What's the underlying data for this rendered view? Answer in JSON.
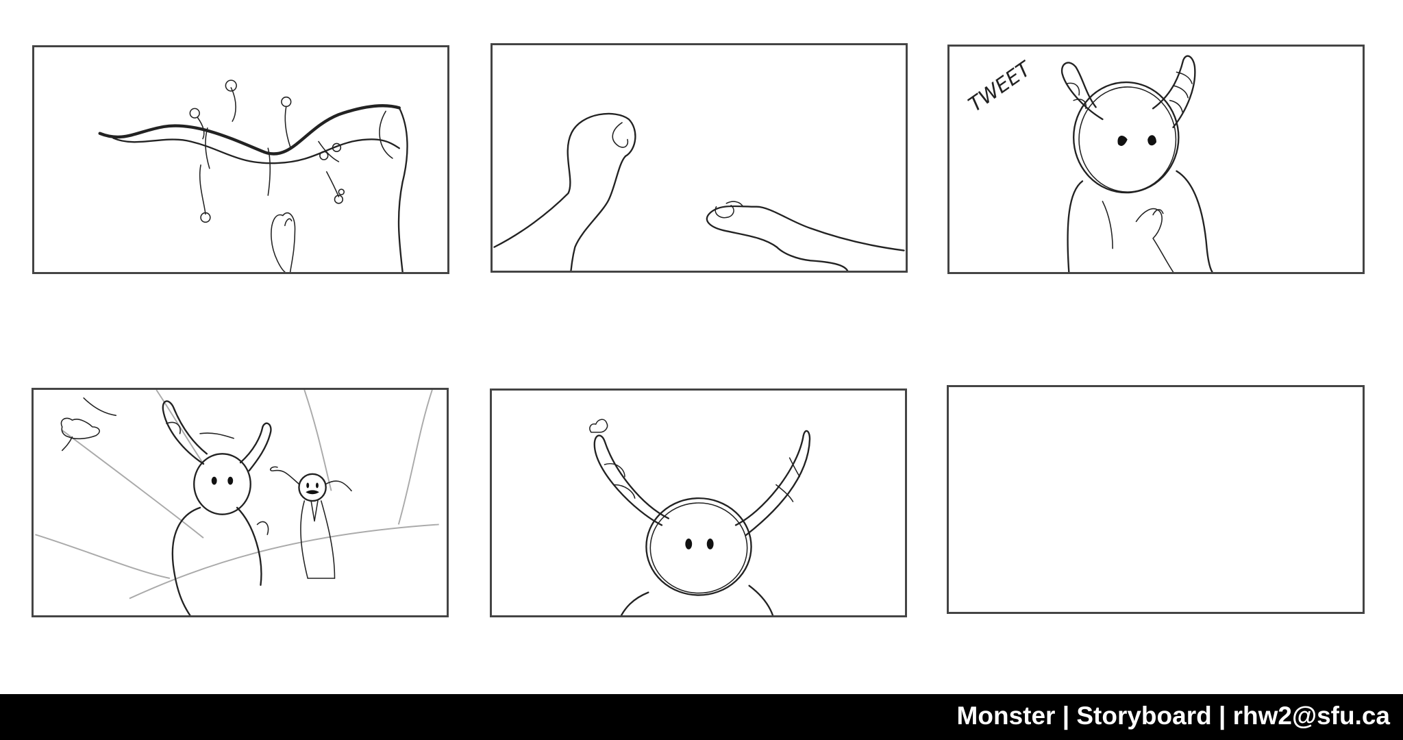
{
  "storyboard": {
    "panels": [
      {
        "id": 1,
        "sound_effect": ""
      },
      {
        "id": 2,
        "sound_effect": ""
      },
      {
        "id": 3,
        "sound_effect": "TWEET"
      },
      {
        "id": 4,
        "sound_effect": ""
      },
      {
        "id": 5,
        "sound_effect": ""
      },
      {
        "id": 6,
        "sound_effect": ""
      }
    ]
  },
  "footer": {
    "text": "Monster | Storyboard | rhw2@sfu.ca",
    "background": "#000000",
    "color": "#ffffff"
  },
  "colors": {
    "border": "#444444",
    "sketch": "#222222"
  }
}
